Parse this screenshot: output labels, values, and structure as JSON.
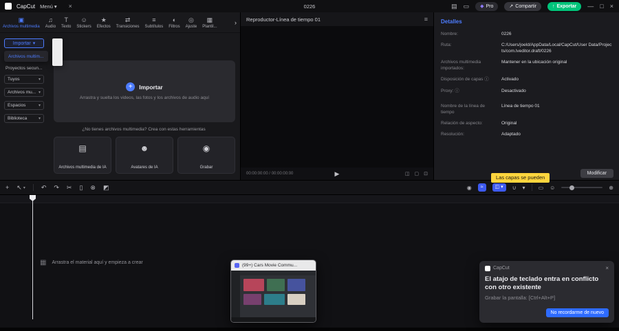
{
  "titlebar": {
    "app_name": "CapCut",
    "menu_label": "Menú",
    "project_title": "0226",
    "pro_label": "Pro",
    "share_label": "Compartir",
    "export_label": "Exportar"
  },
  "media_panel": {
    "tabs": [
      {
        "label": "Archivos multimedia"
      },
      {
        "label": "Audio"
      },
      {
        "label": "Texto"
      },
      {
        "label": "Stickers"
      },
      {
        "label": "Efectos"
      },
      {
        "label": "Transiciones"
      },
      {
        "label": "Subtítulos"
      },
      {
        "label": "Filtros"
      },
      {
        "label": "Ajuste"
      },
      {
        "label": "Plantil..."
      }
    ],
    "sidebar": {
      "import_label": "Importar",
      "dropdown_item": "Archivos multim...",
      "projects_label": "Proyectos secun...",
      "selects": [
        {
          "label": "Tuyos"
        },
        {
          "label": "Archivos mu..."
        },
        {
          "label": "Espacios"
        },
        {
          "label": "Biblioteca"
        }
      ]
    },
    "import_zone": {
      "button_label": "Importar",
      "hint": "Arrastra y suelta los videos, las fotos y los archivos de audio aquí"
    },
    "tools": {
      "heading": "¿No tienes archivos multimedia? Crea con estas herramientas",
      "cards": [
        {
          "label": "Archivos multimedia de IA"
        },
        {
          "label": "Avatares de IA"
        },
        {
          "label": "Grabar"
        }
      ]
    }
  },
  "player": {
    "title": "Reproductor-Línea de tiempo 01",
    "time": "00:00:00:00 / 00:00:00:00"
  },
  "details": {
    "title": "Detalles",
    "rows": [
      {
        "label": "Nombre:",
        "value": "0226"
      },
      {
        "label": "Ruta:",
        "value": "C:/Users/joeld/AppData/Local/CapCut/User Data/Projects/com.lveditor.draft/0226"
      },
      {
        "label": "Archivos multimedia importados:",
        "value": "Mantener en la ubicación original"
      },
      {
        "label": "Disposición de capas ⓘ",
        "value": "Activado"
      },
      {
        "label": "Proxy: ⓘ",
        "value": "Desactivado"
      },
      {
        "label": "Nombre de la línea de tiempo",
        "value": "Línea de tiempo 01"
      },
      {
        "label": "Relación de aspecto:",
        "value": "Original"
      },
      {
        "label": "Resolución:",
        "value": "Adaptado"
      }
    ],
    "modify_label": "Modificar",
    "tooltip": "Las capas se pueden"
  },
  "timeline": {
    "empty_hint": "Arrastra el material aquí y empieza a crear"
  },
  "preview_window": {
    "title": "(99+) Cars Movie Commu..."
  },
  "toast": {
    "app": "CapCut",
    "title": "El atajo de teclado entra en conflicto con otro existente",
    "subtitle": "Grabar la pantalla: [Ctrl+Alt+P]",
    "button_label": "No recordarme de nuevo"
  },
  "colors": {
    "accent_blue": "#4d7cff",
    "export_green": "#00c47a",
    "tooltip_yellow": "#ffd53e",
    "toast_button_blue": "#2e6bff"
  },
  "icons": {
    "menu_caret": "▾",
    "close_small": "×",
    "layout": "▤",
    "feedback": "▭",
    "pro_diamond": "◆",
    "share_arrow": "↗",
    "export_arrow": "↑",
    "minimize": "—",
    "maximize": "□",
    "close": "×",
    "tab_media": "▣",
    "tab_audio": "♫",
    "tab_text": "T",
    "tab_stickers": "☺",
    "tab_effects": "★",
    "tab_transitions": "⇄",
    "tab_subtitles": "≡",
    "tab_filters": "◐",
    "tab_adjust": "◎",
    "tab_templates": "▦",
    "tabs_scroll": "›",
    "caret_down": "▾",
    "import_plus": "+",
    "card_media": "▤",
    "card_avatar": "☻",
    "card_record": "◉",
    "player_menu": "≡",
    "play": "▶",
    "pc_ratio": "◫",
    "pc_expand": "▢",
    "pc_full": "⊡",
    "tb_add": "+",
    "tb_select": "↖",
    "tb_undo": "↶",
    "tb_redo": "↷",
    "tb_split": "✂",
    "tb_trim": "▯",
    "tb_delete": "⊗",
    "tb_mask": "◩",
    "tb_mic": "◉",
    "tb_record": "≈",
    "tb_tracks": "◫",
    "tb_magnet": "∪",
    "tb_capture": "▭",
    "tb_emoji": "☺",
    "tb_zoom": "⊕",
    "tl_media": "▦"
  }
}
